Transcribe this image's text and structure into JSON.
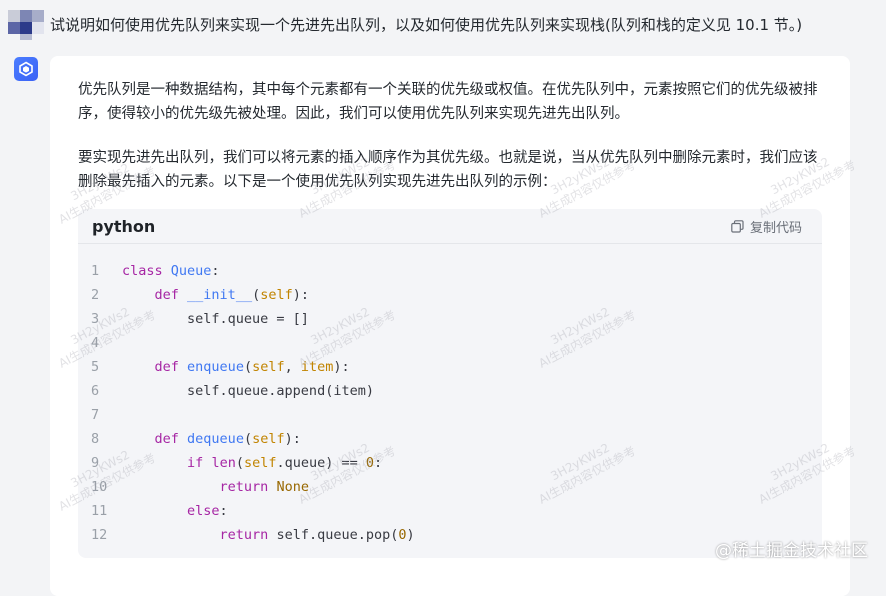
{
  "question": "试说明如何使用优先队列来实现一个先进先出队列，以及如何使用优先队列来实现栈(队列和栈的定义见 10.1 节。)",
  "answer": {
    "paragraphs": [
      "优先队列是一种数据结构，其中每个元素都有一个关联的优先级或权值。在优先队列中，元素按照它们的优先级被排序，使得较小的优先级先被处理。因此，我们可以使用优先队列来实现先进先出队列。",
      "要实现先进先出队列，我们可以将元素的插入顺序作为其优先级。也就是说，当从优先队列中删除元素时，我们应该删除最先插入的元素。以下是一个使用优先队列实现先进先出队列的示例："
    ],
    "code_block": {
      "language": "python",
      "copy_label": "复制代码",
      "lines": [
        {
          "n": "1",
          "code": "class Queue:"
        },
        {
          "n": "2",
          "code": "    def __init__(self):"
        },
        {
          "n": "3",
          "code": "        self.queue = []"
        },
        {
          "n": "4",
          "code": ""
        },
        {
          "n": "5",
          "code": "    def enqueue(self, item):"
        },
        {
          "n": "6",
          "code": "        self.queue.append(item)"
        },
        {
          "n": "7",
          "code": ""
        },
        {
          "n": "8",
          "code": "    def dequeue(self):"
        },
        {
          "n": "9",
          "code": "        if len(self.queue) == 0:"
        },
        {
          "n": "10",
          "code": "            return None"
        },
        {
          "n": "11",
          "code": "        else:"
        },
        {
          "n": "12",
          "code": "            return self.queue.pop(0)"
        }
      ]
    }
  },
  "watermark": {
    "line1": "3H2yKWs2",
    "line2": "AI生成内容仅供参考"
  },
  "site_mark": "@稀土掘金技术社区",
  "colors": {
    "accent": "#3b62f5",
    "keyword": "#a626a4",
    "function": "#4078f2",
    "param": "#c18401",
    "number": "#986801"
  }
}
